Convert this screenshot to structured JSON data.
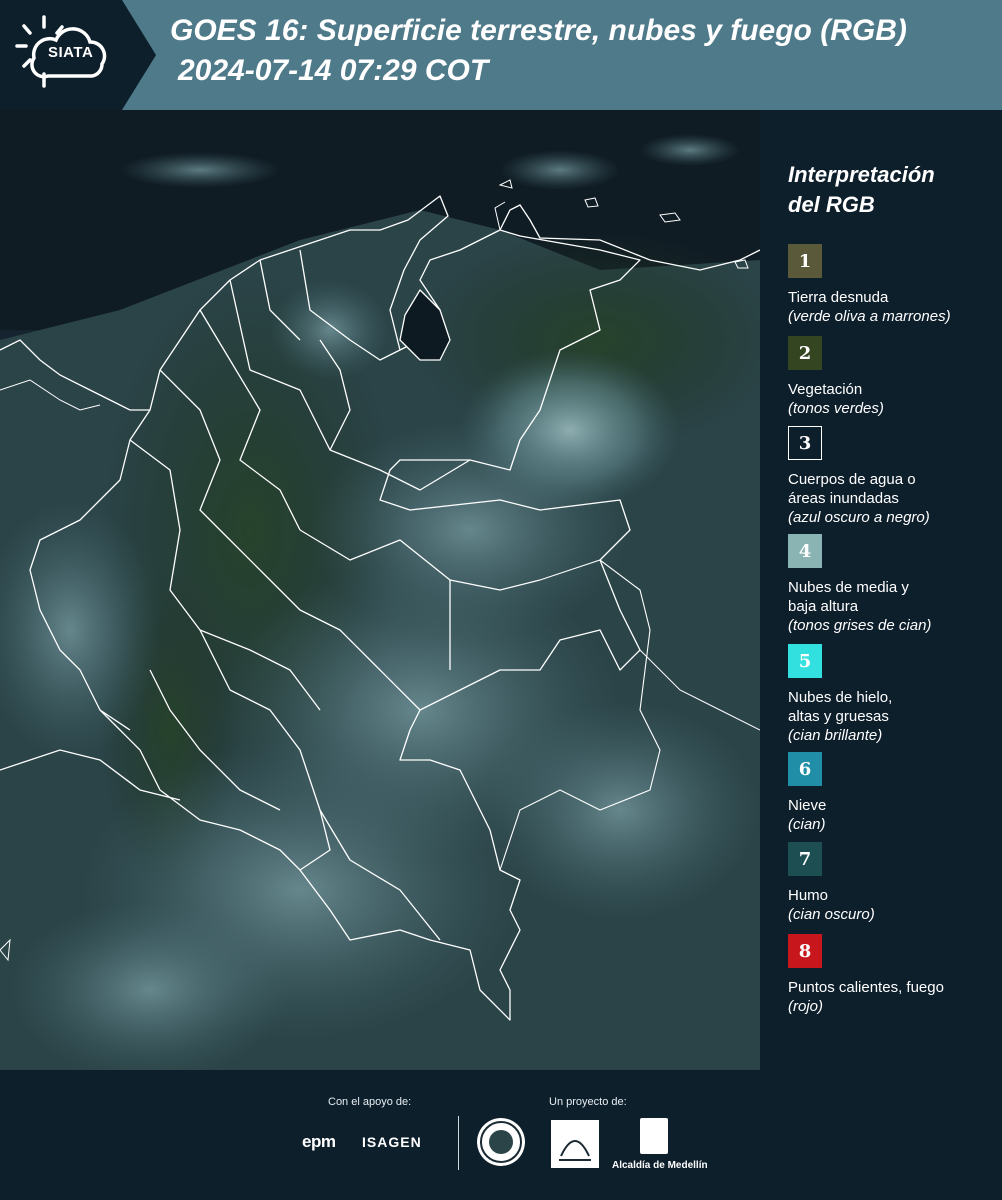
{
  "header": {
    "logo_text": "SIATA",
    "title_line1": "GOES 16: Superficie terrestre, nubes y fuego (RGB)",
    "title_line2": "2024-07-14 07:29 COT"
  },
  "legend": {
    "title_line1": "Interpretación",
    "title_line2": "del RGB",
    "items": [
      {
        "number": "1",
        "label": "Tierra desnuda",
        "desc": "(verde oliva a marrones)",
        "color": "#5a5a3a",
        "border": "#5a5a3a",
        "text_color": "#ffffff"
      },
      {
        "number": "2",
        "label": "Vegetación",
        "desc": "(tonos verdes)",
        "color": "#334521",
        "border": "#334521",
        "text_color": "#ffffff"
      },
      {
        "number": "3",
        "label": "Cuerpos de agua o áreas inundadas",
        "desc": "(azul oscuro a negro)",
        "color": "#0e1f2c",
        "border": "#ffffff",
        "text_color": "#ffffff"
      },
      {
        "number": "4",
        "label": "Nubes de media y baja altura",
        "desc": "(tonos grises de cian)",
        "color": "#8ab4b4",
        "border": "#8ab4b4",
        "text_color": "#ffffff"
      },
      {
        "number": "5",
        "label": "Nubes de hielo, altas y gruesas",
        "desc": "(cian brillante)",
        "color": "#33e0e0",
        "border": "#33e0e0",
        "text_color": "#ffffff"
      },
      {
        "number": "6",
        "label": "Nieve",
        "desc": "(cian)",
        "color": "#1f8ea6",
        "border": "#1f8ea6",
        "text_color": "#ffffff"
      },
      {
        "number": "7",
        "label": "Humo",
        "desc": "(cian oscuro)",
        "color": "#1c4e52",
        "border": "#1c4e52",
        "text_color": "#ffffff"
      },
      {
        "number": "8",
        "label": "Puntos calientes, fuego",
        "desc": "(rojo)",
        "color": "#c8161d",
        "border": "#c8161d",
        "text_color": "#ffffff"
      }
    ]
  },
  "footer": {
    "support_label": "Con el apoyo de:",
    "project_label": "Un proyecto de:",
    "epm": "epm",
    "isagen": "ISAGEN",
    "alcaldia": "Alcaldía de Medellín"
  }
}
